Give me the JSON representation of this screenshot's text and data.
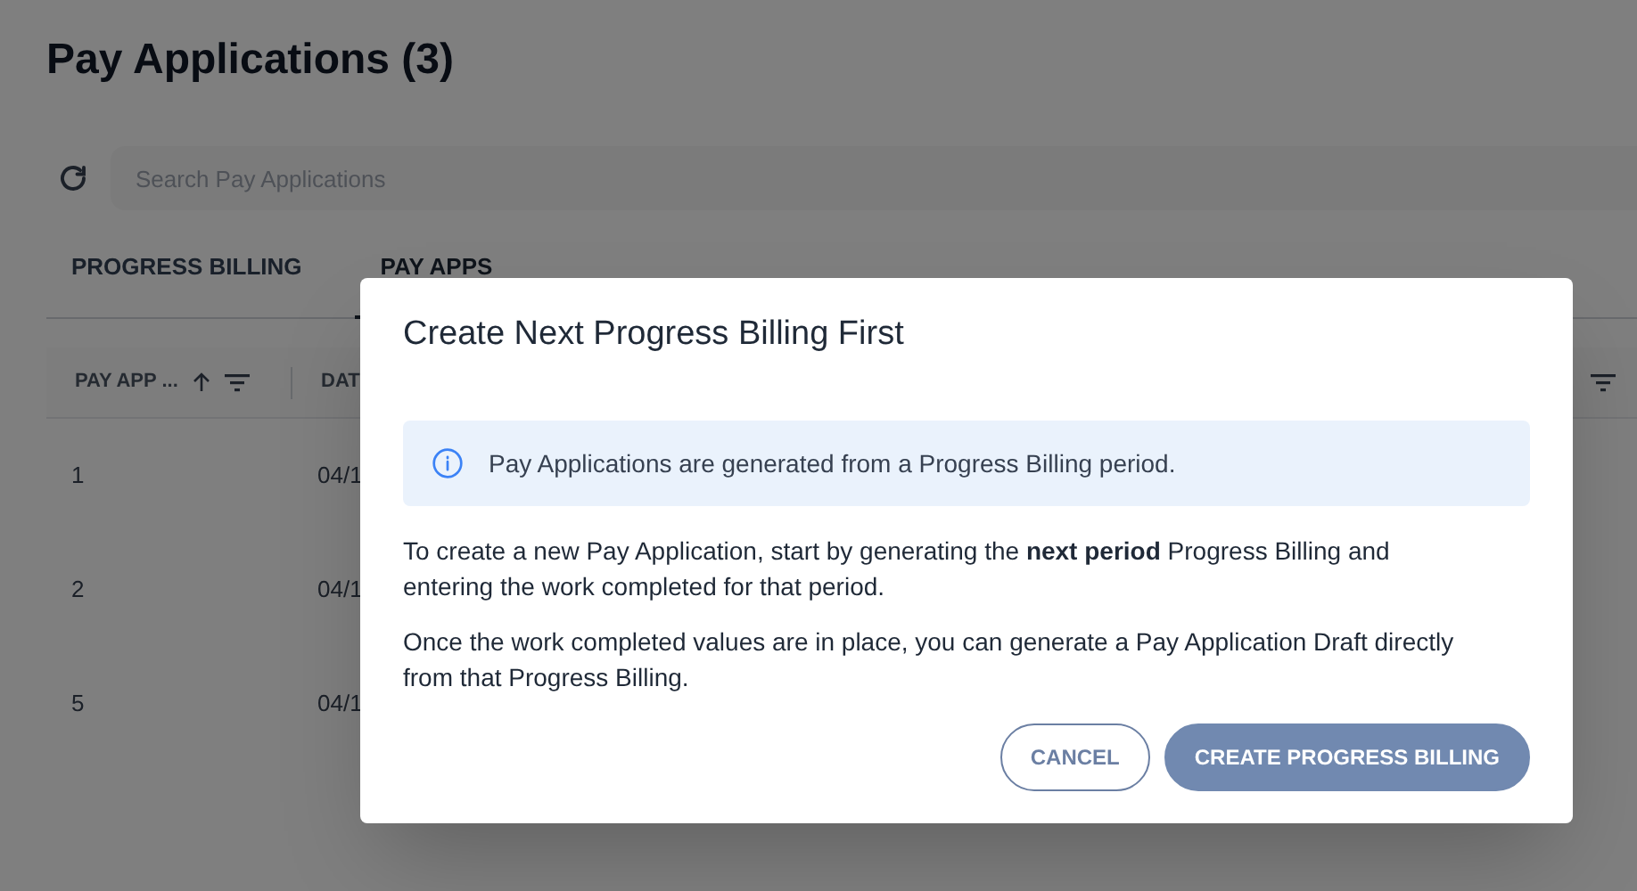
{
  "page": {
    "title": "Pay Applications (3)"
  },
  "search": {
    "placeholder": "Search Pay Applications"
  },
  "tabs": [
    {
      "label": "PROGRESS BILLING",
      "selected": false
    },
    {
      "label": "PAY APPS",
      "selected": true
    }
  ],
  "table": {
    "columns": [
      "PAY APP ...",
      "DAT"
    ],
    "rows": [
      [
        "1",
        "04/1"
      ],
      [
        "2",
        "04/1"
      ],
      [
        "5",
        "04/1"
      ]
    ]
  },
  "dialog": {
    "title": "Create Next Progress Billing First",
    "info": "Pay Applications are generated from a Progress Billing period.",
    "paragraphs": [
      "To create a new Pay Application, start by generating the **next period** Progress Billing and entering the work completed for that period.",
      "Once the work completed values are in place, you can generate a Pay Application Draft directly from that Progress Billing."
    ],
    "buttons": [
      {
        "label": "CANCEL",
        "kind": "outlined"
      },
      {
        "label": "CREATE PROGRESS BILLING",
        "kind": "filled"
      }
    ]
  }
}
